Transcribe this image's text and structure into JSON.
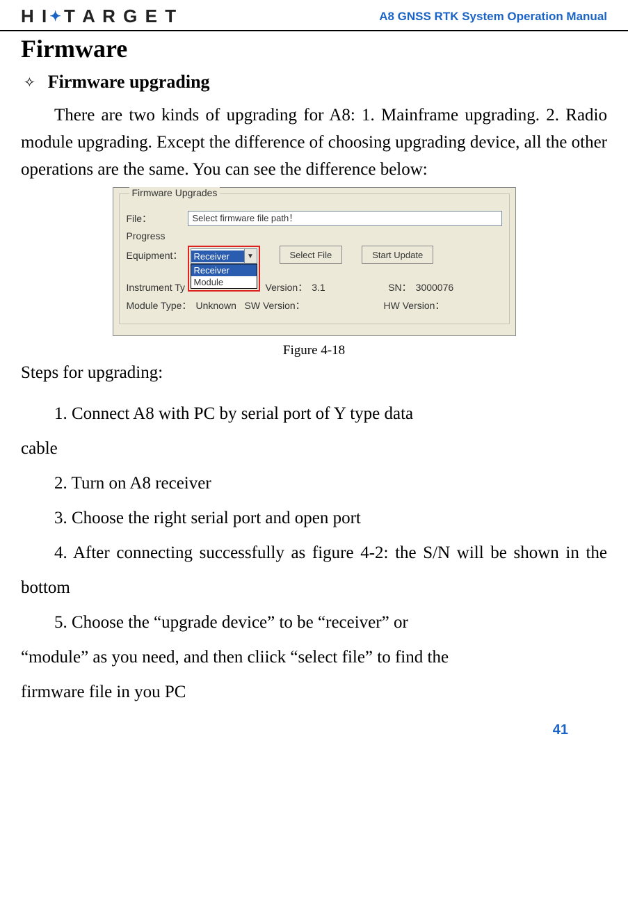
{
  "header": {
    "logo_hi": "H I",
    "logo_target": "T A R G E T",
    "title": "A8  GNSS RTK System Operation Manual"
  },
  "h1": "Firmware",
  "h2": "Firmware upgrading",
  "para1": "There are two kinds of upgrading for A8: 1. Mainframe upgrading. 2. Radio module upgrading. Except the difference of choosing upgrading device, all the other operations are the same. You can see the difference below:",
  "figure": {
    "legend": "Firmware Upgrades",
    "file_label": "File：",
    "file_value": "Select firmware file path！",
    "progress_label": "Progress",
    "equipment_label": "Equipment：",
    "equip_selected": "Receiver",
    "equip_option1": "Receiver",
    "equip_option2": "Module",
    "btn_select": "Select File",
    "btn_start": "Start Update",
    "instrument_label": "Instrument Ty",
    "version_label": "Version：",
    "version_val": "3.1",
    "sn_label": "SN：",
    "sn_val": "3000076",
    "module_type_label": "Module Type：",
    "module_type_val": "Unknown",
    "sw_label": "SW Version：",
    "hw_label": "HW Version："
  },
  "fig_caption": "Figure 4-18",
  "steps_intro": "Steps for upgrading:",
  "step1a": "1.  Connect A8 with PC by serial port of Y type data",
  "step1b": "cable",
  "step2": "2. Turn on A8 receiver",
  "step3": "3. Choose the right serial port and open port",
  "step4": "4. After connecting successfully as figure 4-2: the S/N will be shown in the bottom",
  "step5a": "5. Choose the “upgrade device” to be “receiver” or",
  "step5b": "“module” as you need, and then cliick “select file” to find the",
  "step5c": "firmware file in you PC",
  "page_num": "41"
}
